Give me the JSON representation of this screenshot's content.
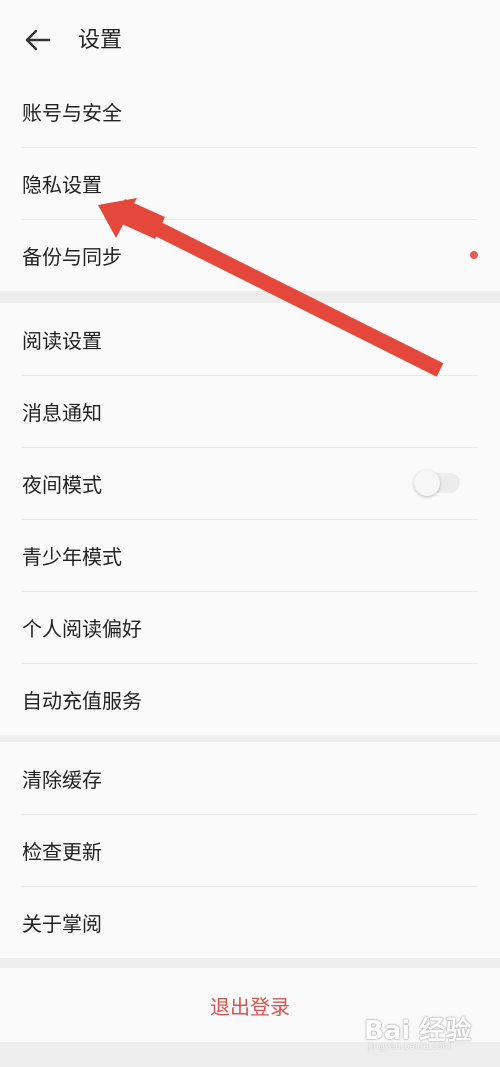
{
  "header": {
    "title": "设置"
  },
  "groups": [
    {
      "items": [
        {
          "label": "账号与安全"
        },
        {
          "label": "隐私设置"
        },
        {
          "label": "备份与同步"
        }
      ]
    },
    {
      "items": [
        {
          "label": "阅读设置"
        },
        {
          "label": "消息通知"
        },
        {
          "label": "夜间模式"
        },
        {
          "label": "青少年模式"
        },
        {
          "label": "个人阅读偏好"
        },
        {
          "label": "自动充值服务"
        }
      ]
    },
    {
      "items": [
        {
          "label": "清除缓存"
        },
        {
          "label": "检查更新"
        },
        {
          "label": "关于掌阅"
        }
      ]
    }
  ],
  "night_mode_enabled": false,
  "logout_label": "退出登录",
  "watermark": {
    "text": "Bai 经验",
    "sub": "jingyan.baidu.com"
  },
  "colors": {
    "accent_red": "#e35b56",
    "logout_red": "#d9534f",
    "annotation_arrow": "#e5473a"
  }
}
